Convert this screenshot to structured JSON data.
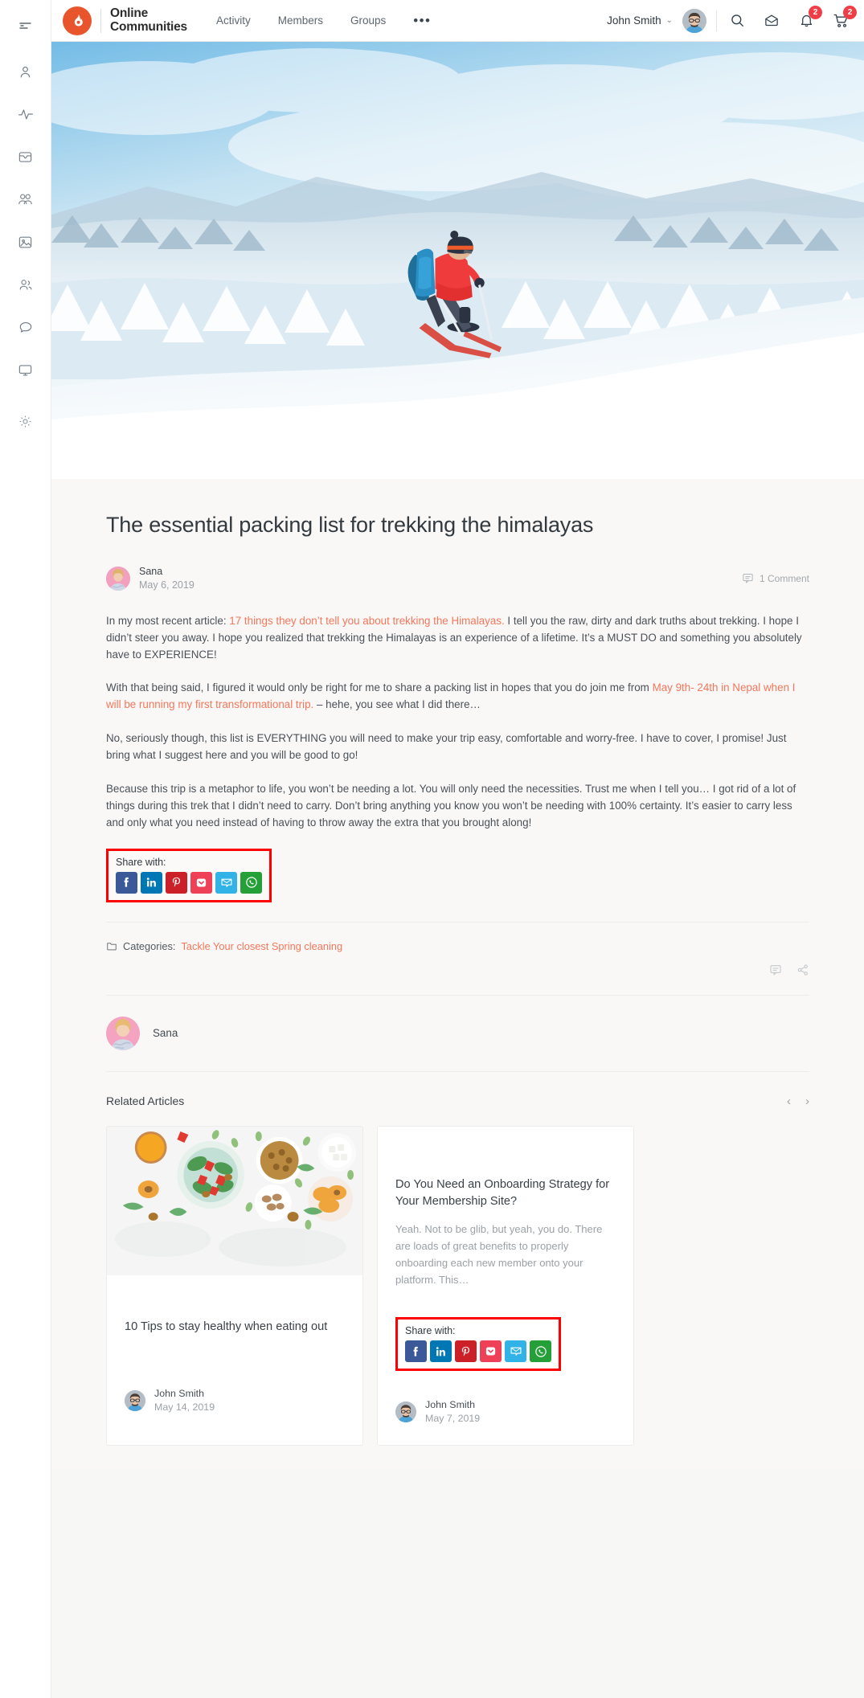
{
  "rail": {
    "toggle": "menu-collapse-icon",
    "items": [
      {
        "name": "profile-icon",
        "label": "Profile"
      },
      {
        "name": "activity-icon",
        "label": "Activity"
      },
      {
        "name": "inbox-icon",
        "label": "Messages"
      },
      {
        "name": "groups-icon",
        "label": "Groups"
      },
      {
        "name": "media-icon",
        "label": "Media"
      },
      {
        "name": "friends-icon",
        "label": "Friends"
      },
      {
        "name": "forums-icon",
        "label": "Forums"
      },
      {
        "name": "screen-icon",
        "label": "Courses"
      }
    ],
    "bottom": {
      "name": "settings-gear-icon",
      "label": "Settings"
    }
  },
  "header": {
    "brand": {
      "line1": "Online",
      "line2": "Communities"
    },
    "nav": [
      {
        "label": "Activity"
      },
      {
        "label": "Members"
      },
      {
        "label": "Groups"
      }
    ],
    "more_label": "•••",
    "user": {
      "name": "John Smith",
      "chevron": "⌄"
    },
    "icons": [
      {
        "name": "search-icon",
        "badge": null
      },
      {
        "name": "inbox-icon",
        "badge": null
      },
      {
        "name": "bell-icon",
        "badge": "2"
      },
      {
        "name": "cart-icon",
        "badge": "2"
      }
    ]
  },
  "hero": {
    "alt": "hiker-in-red-jacket-on-snowy-mountain"
  },
  "article": {
    "title": "The essential packing list for trekking the himalayas",
    "author": "Sana",
    "date": "May 6, 2019",
    "comments": "1 Comment",
    "paragraphs": [
      {
        "parts": [
          {
            "text": "In my most recent article: ",
            "link": false
          },
          {
            "text": "17 things they don’t tell you about trekking the Himalayas.",
            "link": true
          },
          {
            "text": "  I tell you the raw, dirty and dark truths about trekking. I hope I didn’t steer you away. I hope you realized that trekking the Himalayas is an experience of a lifetime. It’s a MUST DO and something you absolutely have to EXPERIENCE!",
            "link": false
          }
        ]
      },
      {
        "parts": [
          {
            "text": "With that being said, I figured it would only be right for me to share a packing list in hopes that you do join me from ",
            "link": false
          },
          {
            "text": "May 9th- 24th in Nepal when I will be running my first transformational trip.",
            "link": true
          },
          {
            "text": " – hehe, you see what I did there…",
            "link": false
          }
        ]
      },
      {
        "parts": [
          {
            "text": "No, seriously though, this list is EVERYTHING you will need to make your trip easy, comfortable and worry-free. I have to cover, I promise! Just bring what I suggest here and you will be good to go!",
            "link": false
          }
        ]
      },
      {
        "parts": [
          {
            "text": "Because this trip is a metaphor to life, you won’t be needing a lot. You will only need the necessities. Trust me when I tell you… I got rid of a lot of things during this trek that I didn’t need to carry. Don’t bring anything you know you won’t be needing with 100% certainty. It’s easier to carry less and only what you need instead of having to throw away the extra that you brought along!",
            "link": false
          }
        ]
      }
    ],
    "categories_label": "Categories:",
    "categories_link": "Tackle Your closest Spring cleaning",
    "footer_actions": [
      {
        "name": "comment-icon"
      },
      {
        "name": "share-icon"
      }
    ],
    "author_box": {
      "name": "Sana"
    }
  },
  "share": {
    "label": "Share with:",
    "highlight_color": "#ff0000",
    "buttons": [
      {
        "name": "facebook-share-button",
        "label": "Facebook",
        "color": "#3b5998"
      },
      {
        "name": "linkedin-share-button",
        "label": "LinkedIn",
        "color": "#0077b5"
      },
      {
        "name": "pinterest-share-button",
        "label": "Pinterest",
        "color": "#cb2027"
      },
      {
        "name": "pocket-share-button",
        "label": "Pocket",
        "color": "#ee4056"
      },
      {
        "name": "email-share-button",
        "label": "Email",
        "color": "#32b3e8"
      },
      {
        "name": "whatsapp-share-button",
        "label": "WhatsApp",
        "color": "#25a038"
      }
    ]
  },
  "related": {
    "title": "Related Articles",
    "prev": "‹",
    "next": "›",
    "cards": [
      {
        "image": "healthy-food-flatlay",
        "title": "10 Tips to stay healthy when eating out",
        "excerpt": "",
        "author": "John Smith",
        "date": "May 14, 2019",
        "has_share": false
      },
      {
        "image": "none",
        "title": "Do You Need an Onboarding Strategy for Your Membership Site?",
        "excerpt": "Yeah. Not to be glib, but yeah, you do. There are loads of great benefits to properly onboarding each new member onto your platform. This…",
        "author": "John Smith",
        "date": "May 7, 2019",
        "has_share": true
      }
    ]
  },
  "colors": {
    "accent": "#f4775c",
    "brand": "#e8552d",
    "badge": "#ef3e46",
    "page_bg": "#f7f7f5"
  }
}
